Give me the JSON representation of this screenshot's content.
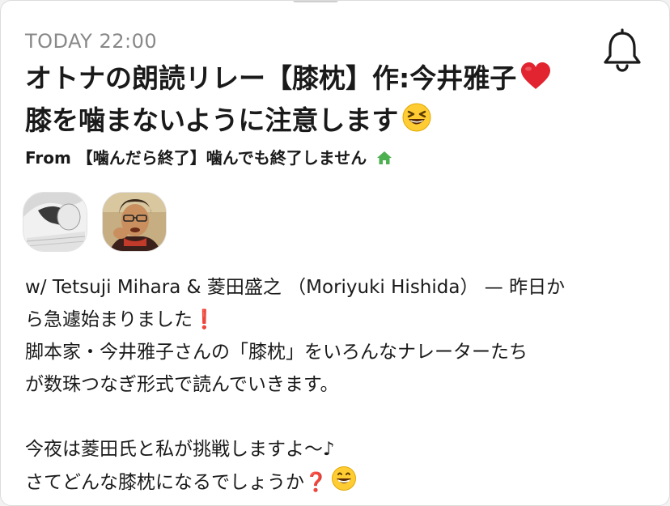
{
  "post": {
    "time": "TODAY 22:00",
    "title_line1": "オトナの朗読リレー【膝枕】作:今井雅子",
    "title_line2": "膝を噛まないように注意します",
    "from": "From 【噛んだら終了】噛んでも終了しません",
    "avatars": [
      {
        "name": "Tetsuji Mihara"
      },
      {
        "name": "菱田盛之"
      }
    ],
    "body_lines": [
      "w/ Tetsuji Mihara & 菱田盛之 （Moriyuki Hishida） — 昨日か",
      "ら急遽始まりました",
      "脚本家・今井雅子さんの「膝枕」をいろんなナレーターたち",
      "が数珠つなぎ形式で読んでいきます。",
      "",
      "今夜は菱田氏と私が挑戦しますよ〜♪",
      "さてどんな膝枕になるでしょうか"
    ],
    "body_marks": {
      "exclamation": "❗",
      "question": "❓"
    }
  },
  "icons": {
    "bell": "bell-icon",
    "heart": "heart-icon",
    "laughing_face": "laughing-face-icon",
    "grinning_face": "grinning-face-icon",
    "house": "house-icon"
  },
  "colors": {
    "accent_red": "#d8262d",
    "room_green": "#4caf50",
    "meta_gray": "#888888",
    "text": "#1a1a1a"
  }
}
